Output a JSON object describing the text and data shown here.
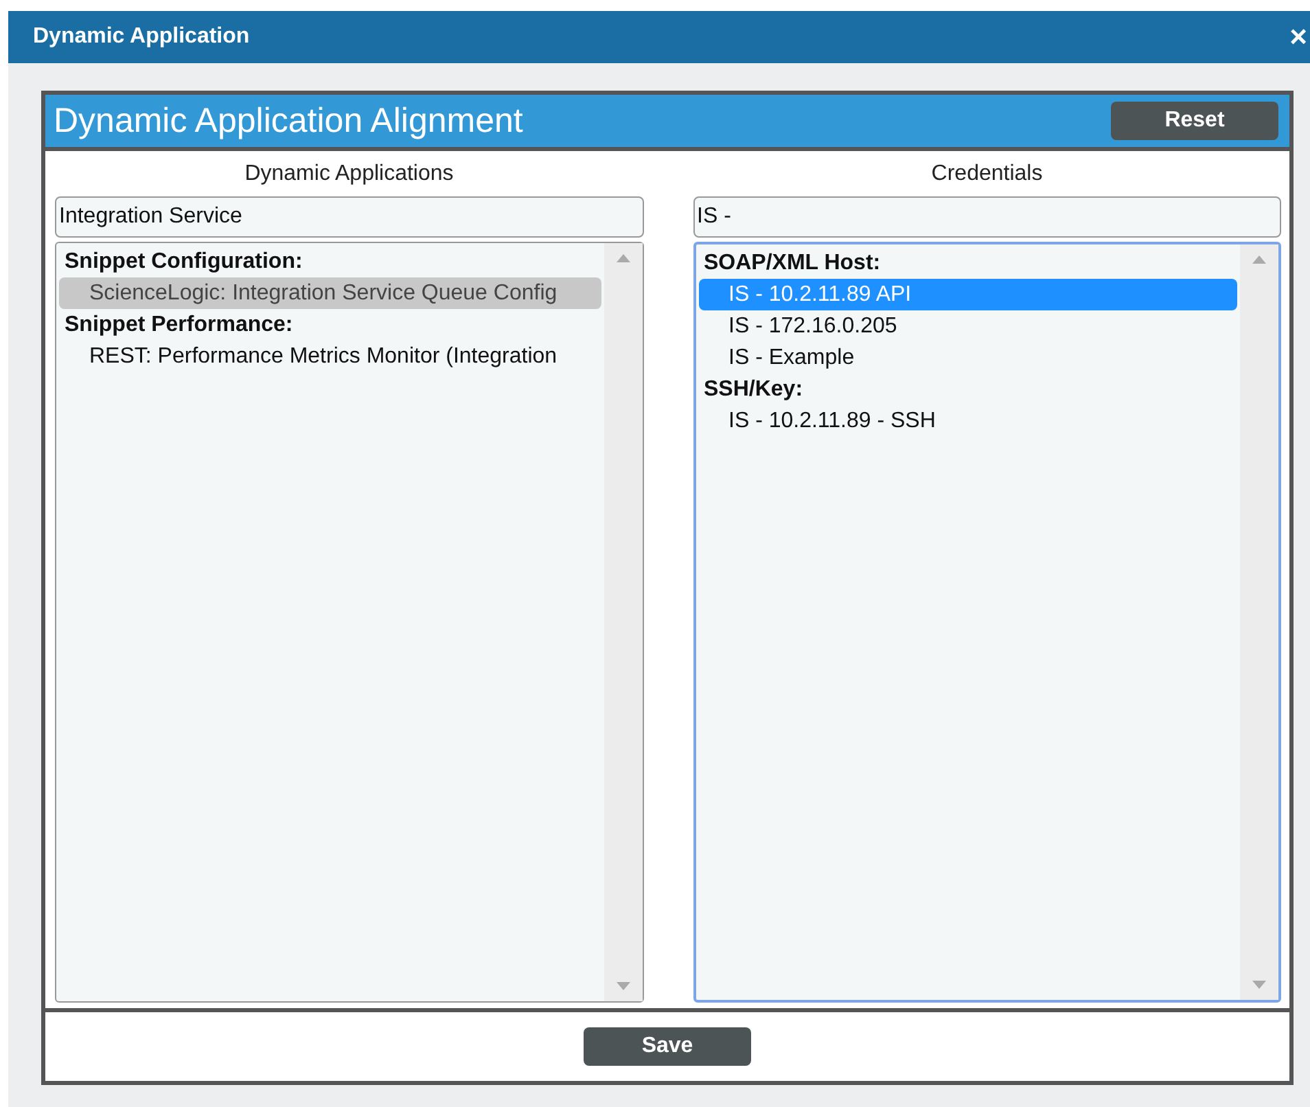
{
  "window": {
    "title": "Dynamic Application",
    "close": "×"
  },
  "panel": {
    "title": "Dynamic Application Alignment",
    "reset_button": "Reset"
  },
  "columns": [
    {
      "heading": "Dynamic Applications",
      "filter": "Integration Service",
      "focused": false,
      "groups": [
        {
          "label": "Snippet Configuration:",
          "items": [
            {
              "label": "ScienceLogic: Integration Service Queue Config",
              "selected": true
            }
          ]
        },
        {
          "label": "Snippet Performance:",
          "items": [
            {
              "label": "REST: Performance Metrics Monitor (Integration",
              "selected": false
            }
          ]
        }
      ]
    },
    {
      "heading": "Credentials",
      "filter": "IS -",
      "focused": true,
      "groups": [
        {
          "label": "SOAP/XML Host:",
          "items": [
            {
              "label": "IS - 10.2.11.89 API",
              "selected": true
            },
            {
              "label": "IS - 172.16.0.205",
              "selected": false
            },
            {
              "label": "IS - Example",
              "selected": false
            }
          ]
        },
        {
          "label": "SSH/Key:",
          "items": [
            {
              "label": "IS - 10.2.11.89 - SSH",
              "selected": false
            }
          ]
        }
      ]
    }
  ],
  "save_button": "Save"
}
